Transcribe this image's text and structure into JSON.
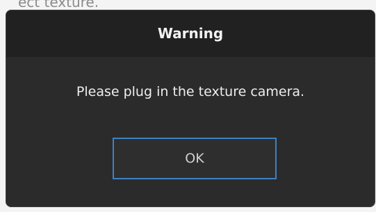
{
  "background": {
    "partial_text": "ect texture."
  },
  "dialog": {
    "title": "Warning",
    "message": "Please plug in the texture camera.",
    "ok_label": "OK"
  },
  "colors": {
    "dialog_bg": "#2b2b2b",
    "title_bar_bg": "#212121",
    "button_border_focus": "#3d82c4",
    "text": "#eeeeee"
  }
}
